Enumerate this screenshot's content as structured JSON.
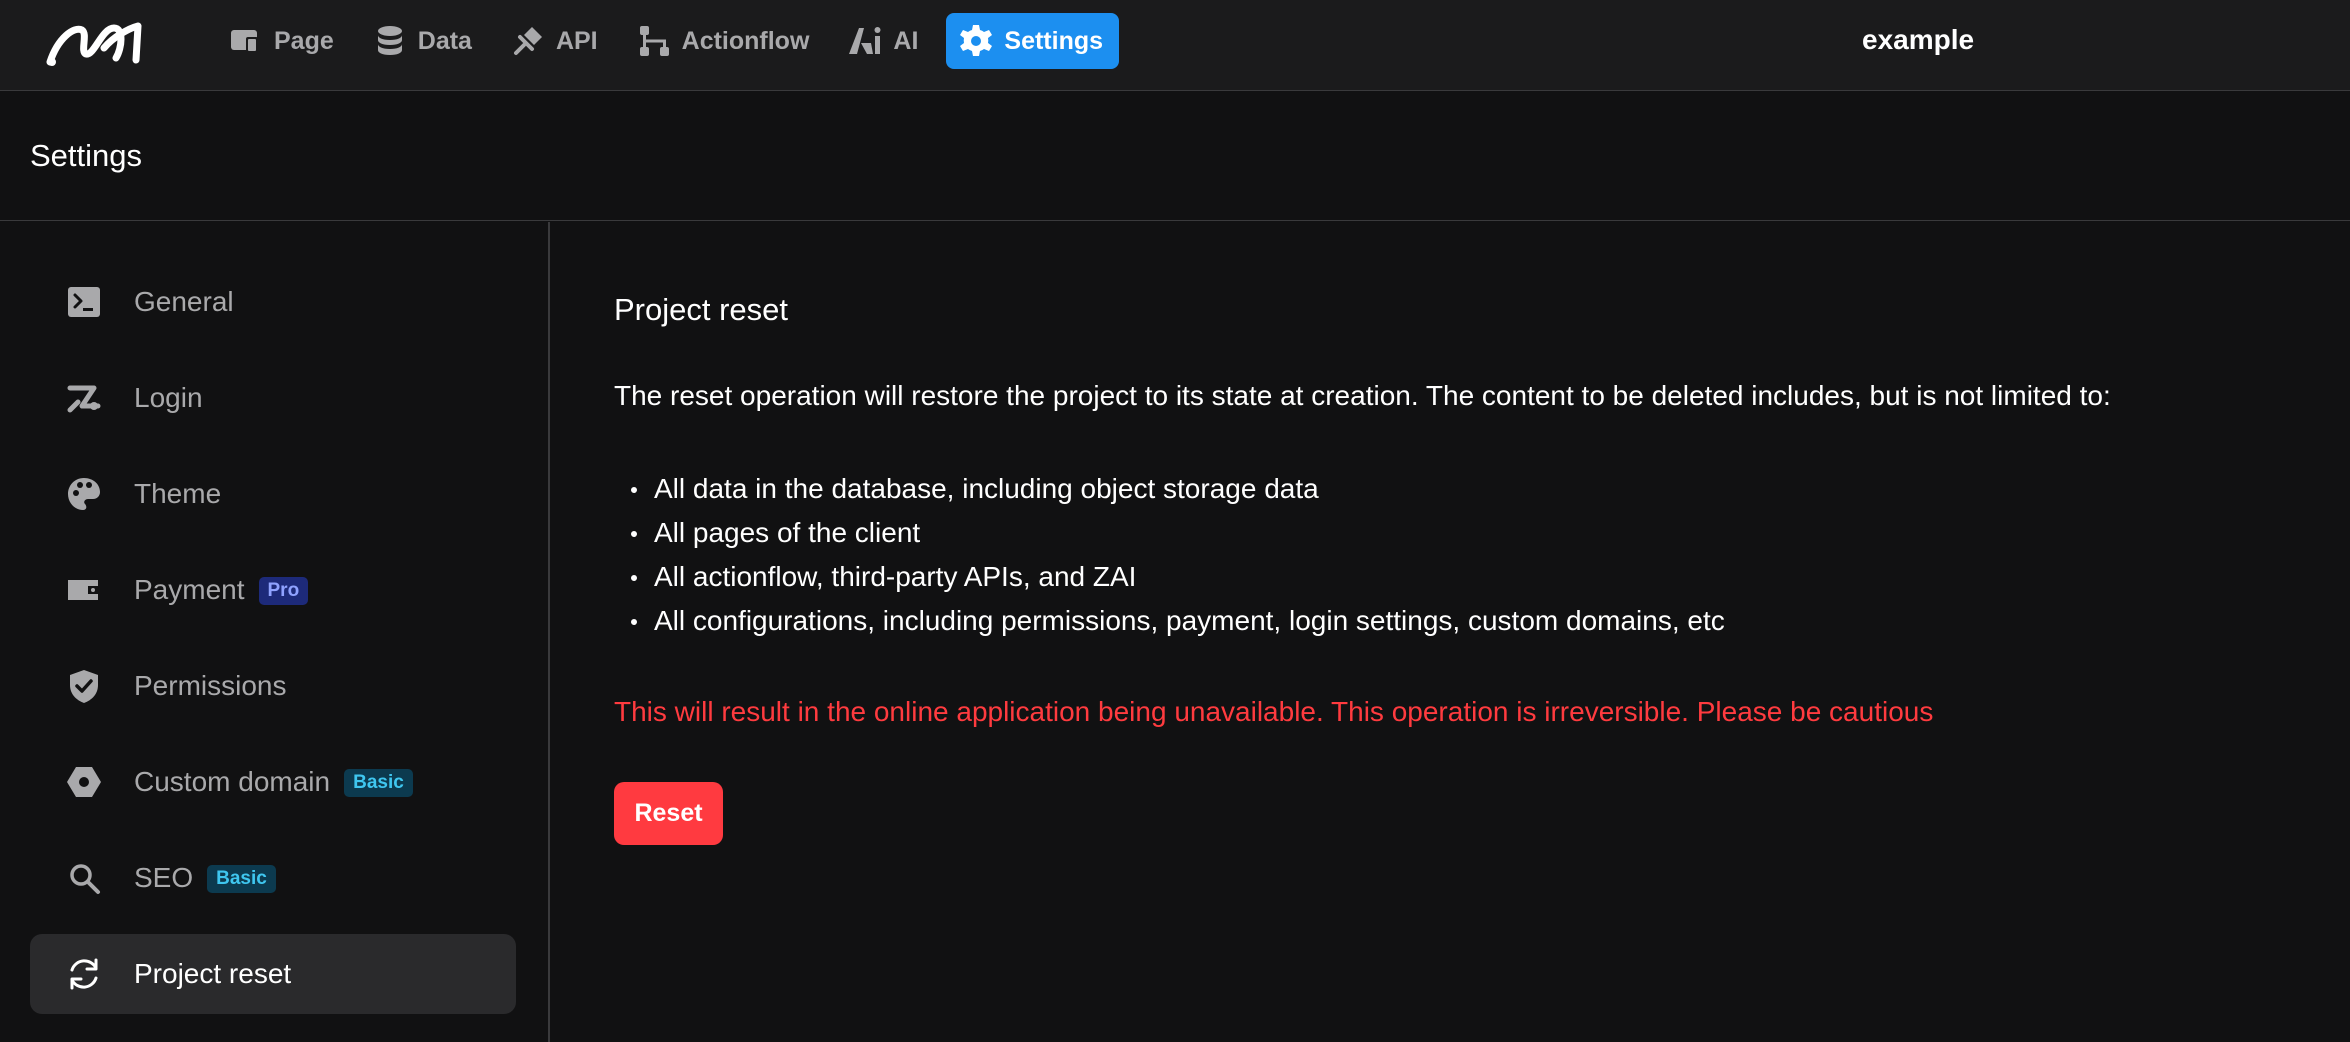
{
  "topbar": {
    "nav": [
      {
        "label": "Page",
        "icon": "page-icon"
      },
      {
        "label": "Data",
        "icon": "database-icon"
      },
      {
        "label": "API",
        "icon": "plug-icon"
      },
      {
        "label": "Actionflow",
        "icon": "flow-icon"
      },
      {
        "label": "AI",
        "icon": "ai-icon"
      },
      {
        "label": "Settings",
        "icon": "gear-icon",
        "active": true
      }
    ],
    "project_name": "example"
  },
  "header": {
    "title": "Settings"
  },
  "sidebar": {
    "items": [
      {
        "label": "General",
        "icon": "terminal-icon"
      },
      {
        "label": "Login",
        "icon": "login-icon"
      },
      {
        "label": "Theme",
        "icon": "palette-icon"
      },
      {
        "label": "Payment",
        "icon": "wallet-icon",
        "badge": "Pro"
      },
      {
        "label": "Permissions",
        "icon": "shield-check-icon"
      },
      {
        "label": "Custom domain",
        "icon": "hexagon-icon",
        "badge": "Basic"
      },
      {
        "label": "SEO",
        "icon": "search-icon",
        "badge": "Basic"
      },
      {
        "label": "Project reset",
        "icon": "refresh-icon",
        "active": true
      }
    ]
  },
  "main": {
    "title": "Project reset",
    "description": "The reset operation will restore the project to its state at creation. The content to be deleted includes, but is not limited to:",
    "bullets": [
      "All data in the database, including object storage data",
      "All pages of the client",
      "All actionflow, third-party APIs, and ZAI",
      "All configurations, including permissions, payment, login settings, custom domains, etc"
    ],
    "warning": "This will result in the online application being unavailable. This operation is irreversible. Please be cautious",
    "reset_label": "Reset"
  },
  "colors": {
    "accent": "#1c8ff0",
    "danger": "#ff3a40",
    "background": "#111112"
  }
}
